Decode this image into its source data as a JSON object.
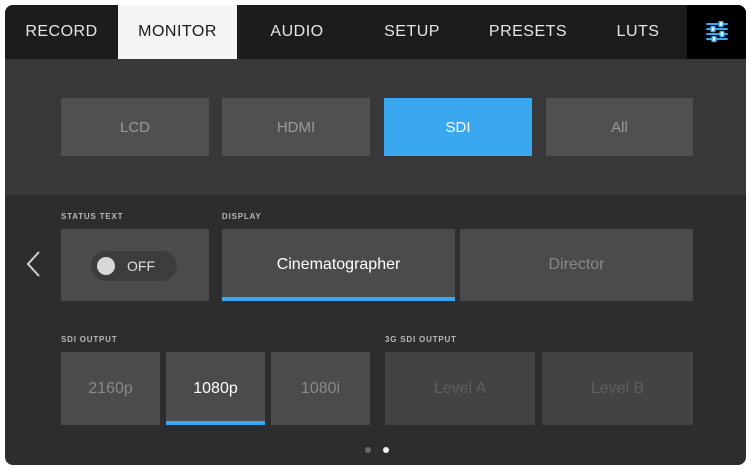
{
  "tabs": [
    {
      "label": "RECORD"
    },
    {
      "label": "MONITOR"
    },
    {
      "label": "AUDIO"
    },
    {
      "label": "SETUP"
    },
    {
      "label": "PRESETS"
    },
    {
      "label": "LUTS"
    }
  ],
  "settings_icon": "sliders-icon",
  "active_tab": "MONITOR",
  "outputs": [
    {
      "label": "LCD"
    },
    {
      "label": "HDMI"
    },
    {
      "label": "SDI"
    },
    {
      "label": "All"
    }
  ],
  "selected_output": "SDI",
  "status_text": {
    "label": "STATUS TEXT",
    "value": "OFF"
  },
  "display": {
    "label": "DISPLAY",
    "options": [
      "Cinematographer",
      "Director"
    ],
    "selected": "Cinematographer"
  },
  "sdi_output": {
    "label": "SDI OUTPUT",
    "options": [
      "2160p",
      "1080p",
      "1080i"
    ],
    "selected": "1080p"
  },
  "sdi3g_output": {
    "label": "3G SDI OUTPUT",
    "options": [
      "Level A",
      "Level B"
    ]
  },
  "pagination": {
    "total": 2,
    "current": 2
  },
  "colors": {
    "accent": "#3aa8f0",
    "tabbar": "#1c1c1e",
    "panel": "#2d2d2f"
  }
}
